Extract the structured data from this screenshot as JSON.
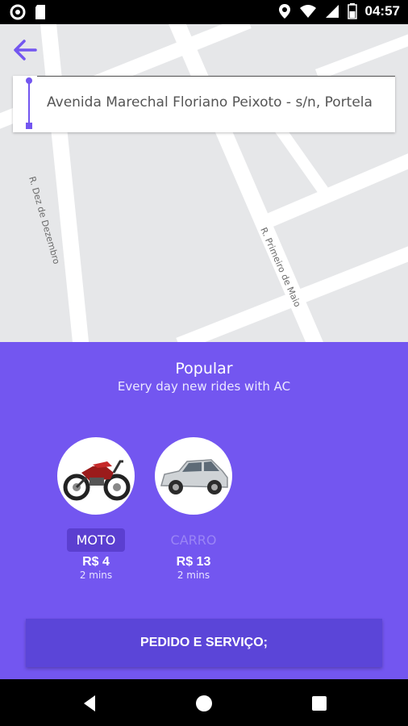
{
  "status_bar": {
    "time": "04:57",
    "left_icons": [
      "circle-notification-icon",
      "sd-card-icon"
    ],
    "right_icons": [
      "location-icon",
      "wifi-icon",
      "signal-icon",
      "battery-icon"
    ]
  },
  "map": {
    "street_labels": [
      "R. Dez de Dezembro",
      "R. Primeiro de Maio"
    ],
    "address": "Avenida Marechal Floriano Peixoto - s/n, Portela"
  },
  "panel": {
    "title": "Popular",
    "subtitle": "Every day new rides with AC",
    "options": [
      {
        "name": "MOTO",
        "price": "R$ 4",
        "eta": "2 mins",
        "selected": true,
        "icon": "motorcycle-image"
      },
      {
        "name": "CARRO",
        "price": "R$ 13",
        "eta": "2 mins",
        "selected": false,
        "icon": "car-image"
      }
    ],
    "order_button": "PEDIDO E SERVIÇO;"
  },
  "colors": {
    "accent": "#7356f0",
    "button": "#5b45d8",
    "selected_chip": "#5b3fd0"
  }
}
